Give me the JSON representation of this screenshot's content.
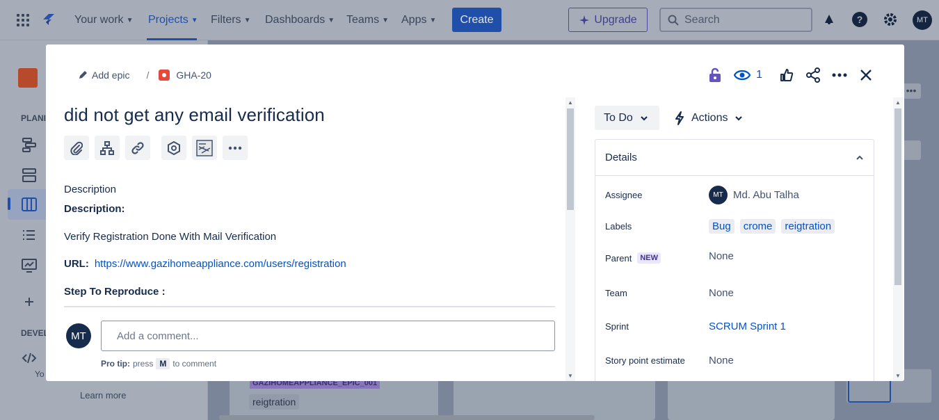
{
  "topnav": {
    "items": [
      {
        "label": "Your work"
      },
      {
        "label": "Projects"
      },
      {
        "label": "Filters"
      },
      {
        "label": "Dashboards"
      },
      {
        "label": "Teams"
      },
      {
        "label": "Apps"
      }
    ],
    "create_label": "Create",
    "upgrade_label": "Upgrade",
    "search_placeholder": "Search",
    "avatar_initials": "MT"
  },
  "sidebar": {
    "planning_label": "PLANI",
    "development_label": "DEVEL",
    "you_text": "Yo",
    "learn_more": "Learn more"
  },
  "board": {
    "epic_chip": "GAZIHOMEAPPLIANCE_EPIC_001",
    "label_chip": "reigtration"
  },
  "modal": {
    "breadcrumb": {
      "add_epic": "Add epic",
      "separator": "/",
      "issue_key": "GHA-20"
    },
    "watch_count": "1",
    "title": "did not get any email verification",
    "description_label": "Description",
    "description_heading": "Description:",
    "description_text": "Verify Registration Done With Mail Verification",
    "url_label": "URL:",
    "url_value": "https://www.gazihomeappliance.com/users/registration",
    "step_heading": "Step To Reproduce :",
    "comment": {
      "avatar_initials": "MT",
      "placeholder": "Add a comment...",
      "pro_tip_bold": "Pro tip:",
      "pro_tip_press": "press",
      "pro_tip_key": "M",
      "pro_tip_rest": "to comment"
    },
    "status_label": "To Do",
    "actions_label": "Actions",
    "details": {
      "heading": "Details",
      "assignee_key": "Assignee",
      "assignee_initials": "MT",
      "assignee_name": "Md. Abu Talha",
      "labels_key": "Labels",
      "labels": [
        "Bug",
        "crome",
        "reigtration"
      ],
      "parent_key": "Parent",
      "parent_badge": "NEW",
      "parent_value": "None",
      "team_key": "Team",
      "team_value": "None",
      "sprint_key": "Sprint",
      "sprint_value": "SCRUM Sprint 1",
      "story_points_key": "Story point estimate",
      "story_points_value": "None"
    }
  }
}
